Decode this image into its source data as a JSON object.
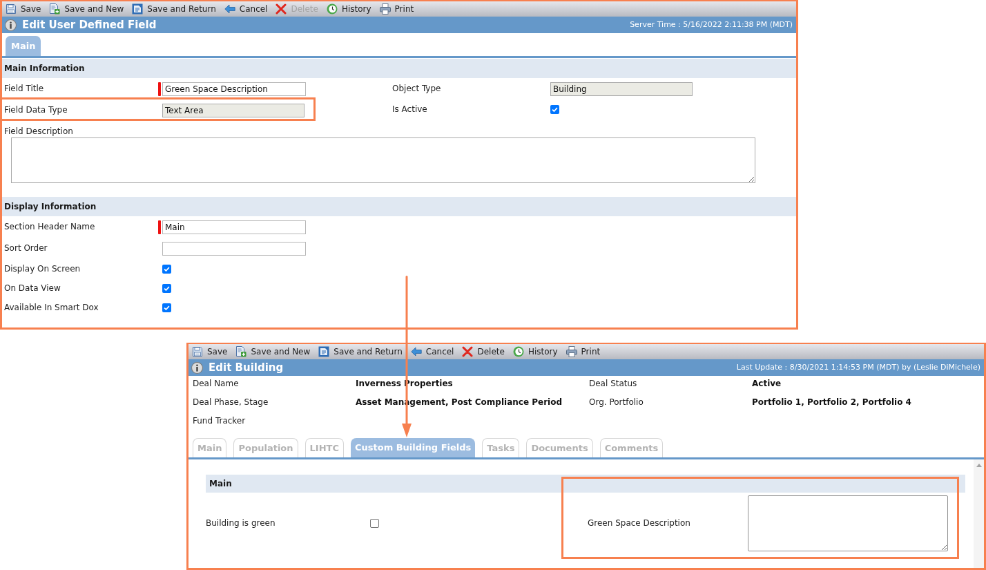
{
  "field_editor": {
    "toolbar": [
      {
        "kind": "save",
        "label": "Save",
        "disabled": false
      },
      {
        "kind": "save_new",
        "label": "Save and New",
        "disabled": false
      },
      {
        "kind": "save_return",
        "label": "Save and Return",
        "disabled": false
      },
      {
        "kind": "cancel",
        "label": "Cancel",
        "disabled": false
      },
      {
        "kind": "delete",
        "label": "Delete",
        "disabled": true
      },
      {
        "kind": "history",
        "label": "History",
        "disabled": false
      },
      {
        "kind": "print",
        "label": "Print",
        "disabled": false
      }
    ],
    "title": "Edit User Defined Field",
    "server_time": "Server Time : 5/16/2022 2:11:38 PM (MDT)",
    "tabs": [
      {
        "label": "Main",
        "selected": true
      }
    ],
    "sections": [
      {
        "heading": "Main Information",
        "rows": [
          [
            {
              "kind": "text",
              "label": "Field Title",
              "value": "Green Space Description",
              "required": true,
              "disabled": false,
              "highlighted": false
            },
            {
              "kind": "text",
              "label": "Object Type",
              "value": "Building",
              "required": false,
              "disabled": true,
              "highlighted": false
            }
          ],
          [
            {
              "kind": "text",
              "label": "Field Data Type",
              "value": "Text Area",
              "required": false,
              "disabled": true,
              "highlighted": true
            },
            {
              "kind": "checkbox",
              "label": "Is Active",
              "checked": true,
              "highlighted": false
            }
          ],
          [
            {
              "kind": "textarea",
              "label": "Field Description",
              "highlighted": false
            }
          ]
        ]
      },
      {
        "heading": "Display Information",
        "rows": [
          [
            {
              "kind": "text",
              "label": "Section Header Name",
              "value": "Main",
              "required": true,
              "disabled": false,
              "highlighted": false
            }
          ],
          [
            {
              "kind": "text",
              "label": "Sort Order",
              "required": false,
              "disabled": false,
              "highlighted": false
            }
          ],
          [
            {
              "kind": "checkbox",
              "label": "Display On Screen",
              "checked": true,
              "highlighted": false
            }
          ],
          [
            {
              "kind": "checkbox",
              "label": "On Data View",
              "checked": true,
              "highlighted": false
            }
          ],
          [
            {
              "kind": "checkbox",
              "label": "Available In Smart Dox",
              "checked": true,
              "highlighted": false
            }
          ]
        ]
      }
    ]
  },
  "building_editor": {
    "toolbar": [
      {
        "kind": "save",
        "label": "Save",
        "disabled": false
      },
      {
        "kind": "save_new",
        "label": "Save and New",
        "disabled": false
      },
      {
        "kind": "save_return",
        "label": "Save and Return",
        "disabled": false
      },
      {
        "kind": "cancel",
        "label": "Cancel",
        "disabled": false
      },
      {
        "kind": "delete",
        "label": "Delete",
        "disabled": false
      },
      {
        "kind": "history",
        "label": "History",
        "disabled": false
      },
      {
        "kind": "print",
        "label": "Print",
        "disabled": false
      }
    ],
    "title": "Edit Building",
    "last_update": "Last Update : 8/30/2021 1:14:53 PM (MDT) by (Leslie DiMichele)",
    "details": [
      [
        {
          "label": "Deal Name",
          "value": "Inverness Properties"
        },
        {
          "label": "Deal Status",
          "value": "Active"
        }
      ],
      [
        {
          "label": "Deal Phase, Stage",
          "value": "Asset Management, Post Compliance Period"
        },
        {
          "label": "Org. Portfolio",
          "value": "Portfolio 1, Portfolio 2, Portfolio 4"
        }
      ],
      [
        {
          "label": "Fund Tracker"
        }
      ]
    ],
    "tabs": [
      {
        "label": "Main",
        "selected": false
      },
      {
        "label": "Population",
        "selected": false
      },
      {
        "label": "LIHTC",
        "selected": false
      },
      {
        "label": "Custom Building Fields",
        "selected": true
      },
      {
        "label": "Tasks",
        "selected": false
      },
      {
        "label": "Documents",
        "selected": false
      },
      {
        "label": "Comments",
        "selected": false
      }
    ],
    "sections": [
      {
        "heading": "Main",
        "rows": [
          [
            {
              "kind": "checkbox",
              "label": "Building is green",
              "checked": false,
              "highlighted": false
            },
            {
              "kind": "textarea",
              "label": "Green Space Description",
              "highlighted": true
            }
          ]
        ]
      }
    ]
  }
}
